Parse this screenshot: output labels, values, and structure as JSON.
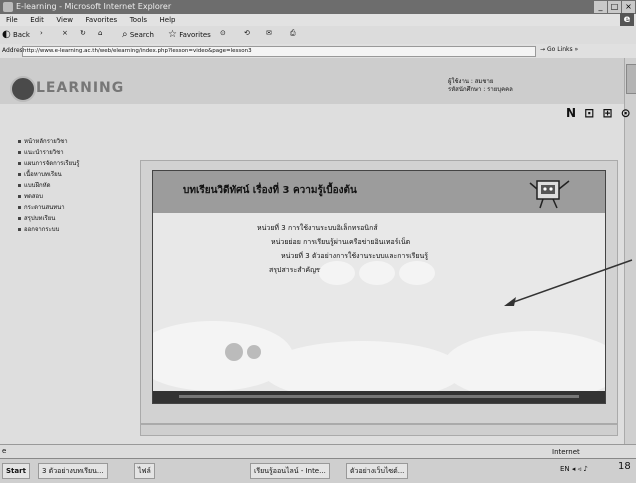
{
  "window": {
    "title": "E-learning - Microsoft Internet Explorer",
    "min": "_",
    "max": "□",
    "close": "×"
  },
  "menu": [
    "File",
    "Edit",
    "View",
    "Favorites",
    "Tools",
    "Help"
  ],
  "toolbar": {
    "back": "Back",
    "forward": "›",
    "stop": "×",
    "refresh": "↻",
    "home": "⌂",
    "search": "Search",
    "favorites": "Favorites",
    "media": "⊙",
    "history": "⟲",
    "mail": "✉",
    "print": "⎙"
  },
  "address": {
    "label": "Address",
    "url": "http://www.e-learning.ac.th/web/elearning/index.php?lesson=video&page=lesson3",
    "go": "Go",
    "links": "Links"
  },
  "brand": {
    "logo_text": "LEARNING"
  },
  "user": {
    "line1": "ผู้ใช้งาน : สมชาย",
    "line2": "รหัสนักศึกษา : รายบุคคล"
  },
  "tools": {
    "icons": "N ⊡ ⊞ ⊙"
  },
  "nav": [
    "หน้าหลักรายวิชา",
    "แนะนำรายวิชา",
    "แผนการจัดการเรียนรู้",
    "เนื้อหาบทเรียน",
    "แบบฝึกหัด",
    "ทดสอบ",
    "กระดานสนทนา",
    "สรุปบทเรียน",
    "ออกจากระบบ"
  ],
  "video": {
    "title": "บทเรียนวิดีทัศน์ เรื่องที่ 3 ความรู้เบื้องต้น",
    "lines": [
      "หน่วยที่ 3 การใช้งานระบบอิเล็กทรอนิกส์",
      "หน่วยย่อย การเรียนรู้ผ่านเครือข่ายอินเทอร์เน็ต",
      "หน่วยที่ 3 ตัวอย่างการใช้งานระบบและการเรียนรู้",
      "สรุปสาระสำคัญของบทเรียน"
    ]
  },
  "status": {
    "icon": "e",
    "zone": "Internet"
  },
  "taskbar": {
    "start": "Start",
    "items": [
      "3 ตัวอย่างบทเรียน...",
      "ไฟล์",
      "เรียนรู้ออนไลน์ - Inte...",
      "ตัวอย่างเว็บไซต์..."
    ],
    "tray": "EN ◂ ◃ ♪",
    "clock": "18"
  }
}
